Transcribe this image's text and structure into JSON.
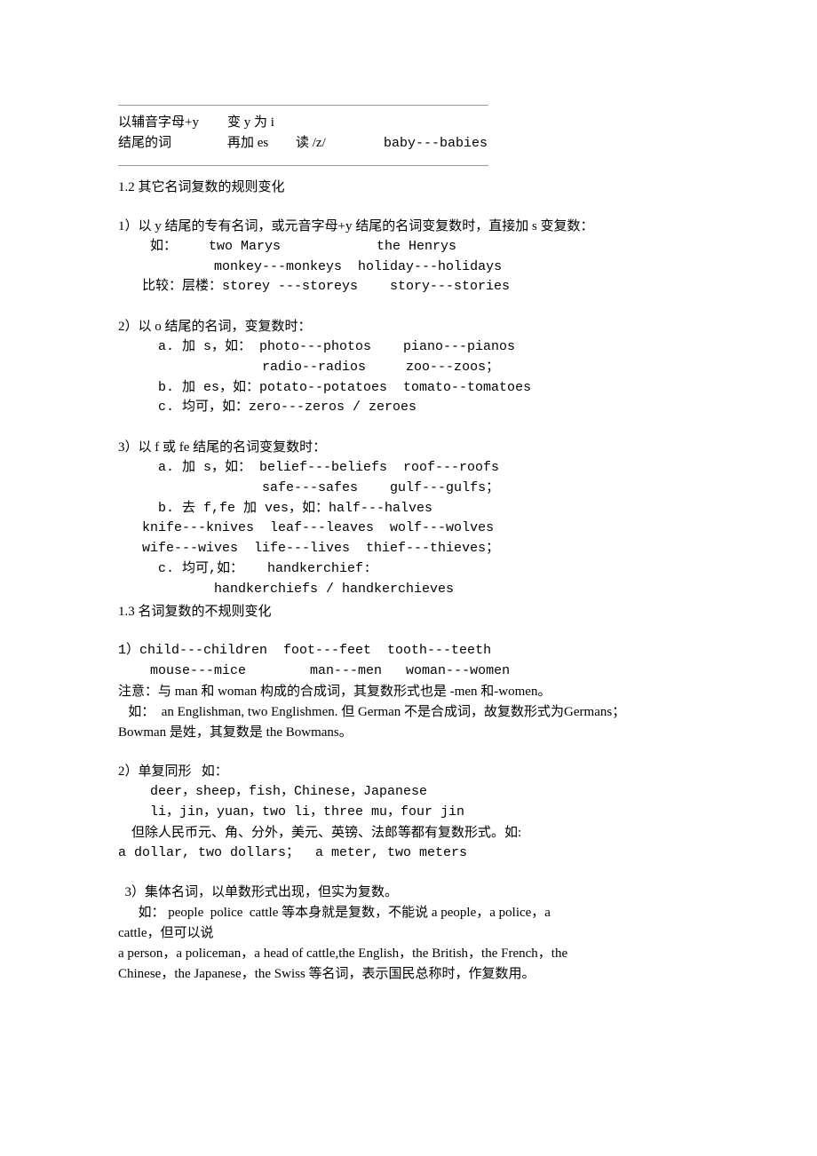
{
  "document": {
    "rule_top": "horizontal-rule",
    "rule_bottom": "horizontal-rule",
    "table_rule": {
      "row1": {
        "c1": "以辅音字母+y",
        "c2": "变 y 为 i",
        "c3": "",
        "c4": ""
      },
      "row2": {
        "c1": "结尾的词",
        "c2": "再加 es",
        "c3": "读 /z/",
        "c4": "baby---babies"
      }
    },
    "section_1_2": {
      "heading": "1.2 其它名词复数的规则变化",
      "item1": {
        "label": "1）以 y 结尾的专有名词，或元音字母+y 结尾的名词变复数时，直接加 s 变复数：",
        "example_intro": "    如：    two Marys            the Henrys",
        "example_line2": "            monkey---monkeys  holiday---holidays",
        "compare_line": "   比较：层楼：storey ---storeys    story---stories"
      },
      "item2": {
        "label": "2）以 o 结尾的名词，变复数时：",
        "a": "     a. 加 s，如： photo---photos    piano---pianos",
        "a2": "                  radio--radios     zoo---zoos；",
        "b": "     b. 加 es，如：potato--potatoes  tomato--tomatoes",
        "c": "     c. 均可，如：zero---zeros / zeroes"
      },
      "item3": {
        "label": "3）以 f 或 fe 结尾的名词变复数时：",
        "a": "     a. 加 s，如： belief---beliefs  roof---roofs",
        "a2": "                  safe---safes    gulf---gulfs；",
        "b": "     b. 去 f,fe 加 ves，如：half---halves",
        "b2": "   knife---knives  leaf---leaves  wolf---wolves",
        "b3": "   wife---wives  life---lives  thief---thieves；",
        "c": "     c. 均可,如：   handkerchief:",
        "c2": "            handkerchiefs / handkerchieves"
      }
    },
    "section_1_3": {
      "heading": "1.3 名词复数的不规则变化",
      "item1": {
        "line1": "1）child---children  foot---feet  tooth---teeth",
        "line2": "    mouse---mice        man---men   woman---women",
        "note": "注意：与 man 和 woman 构成的合成词，其复数形式也是 -men 和-women。",
        "note_ex1": "   如：  an Englishman, two Englishmen. 但 German 不是合成词，故复数形式为Germans；",
        "note_ex2": "Bowman 是姓，其复数是 the Bowmans。"
      },
      "item2": {
        "label": "2）单复同形   如：",
        "line1": "    deer，sheep，fish，Chinese，Japanese",
        "line2": "    li，jin，yuan，two li，three mu，four jin",
        "line3": "    但除人民币元、角、分外，美元、英镑、法郎等都有复数形式。如:",
        "line4": "a dollar, two dollars；  a meter, two meters"
      },
      "item3": {
        "label": "  3）集体名词，以单数形式出现，但实为复数。",
        "line1": "      如： people  police  cattle 等本身就是复数，不能说 a people，a police，a",
        "line2": "cattle，但可以说",
        "line3": "a person，a policeman，a head of cattle,the English，the British，the French，the",
        "line4": "Chinese，the Japanese，the Swiss 等名词，表示国民总称时，作复数用。"
      }
    }
  }
}
